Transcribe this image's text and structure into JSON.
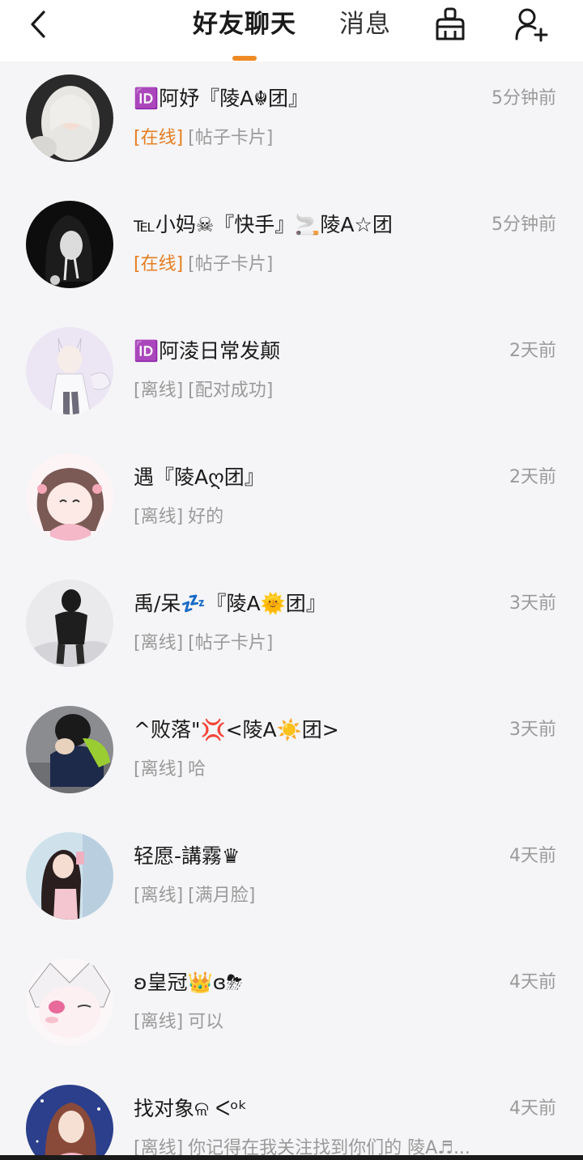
{
  "header": {
    "back_icon": "chevron-left-icon",
    "tab_friends": "好友聊天",
    "tab_messages": "消息",
    "active_color": "#f08a24",
    "clean_icon": "broom-icon",
    "add_friend_icon": "add-user-icon"
  },
  "chats": [
    {
      "name": "🆔阿妤『陵A☬团』",
      "time": "5分钟前",
      "status": "[在线]",
      "online": true,
      "message": "[帖子卡片]"
    },
    {
      "name": "℡小妈☠『快手』🚬陵A☆团",
      "time": "5分钟前",
      "status": "[在线]",
      "online": true,
      "message": "[帖子卡片]"
    },
    {
      "name": "🆔阿淩日常发颠",
      "time": "2天前",
      "status": "[离线]",
      "online": false,
      "message": "[配对成功]"
    },
    {
      "name": "遇『陵Aღ团』",
      "time": "2天前",
      "status": "[离线]",
      "online": false,
      "message": "好的"
    },
    {
      "name": "禹/呆💤『陵A🌞团』",
      "time": "3天前",
      "status": "[离线]",
      "online": false,
      "message": "[帖子卡片]"
    },
    {
      "name": "^败落\"💢<陵A☀️团>",
      "time": "3天前",
      "status": "[离线]",
      "online": false,
      "message": "哈"
    },
    {
      "name": "轻愿-講霧♛",
      "time": "4天前",
      "status": "[离线]",
      "online": false,
      "message": "[满月脸]"
    },
    {
      "name": "ʚ皇冠👑ɞ⛈",
      "time": "4天前",
      "status": "[离线]",
      "online": false,
      "message": "可以"
    },
    {
      "name": "找对象ଳ ᐸᵒᵏ",
      "time": "4天前",
      "status": "[离线]",
      "online": false,
      "message": "你记得在我关注找到你们的      陵A♬..."
    }
  ]
}
